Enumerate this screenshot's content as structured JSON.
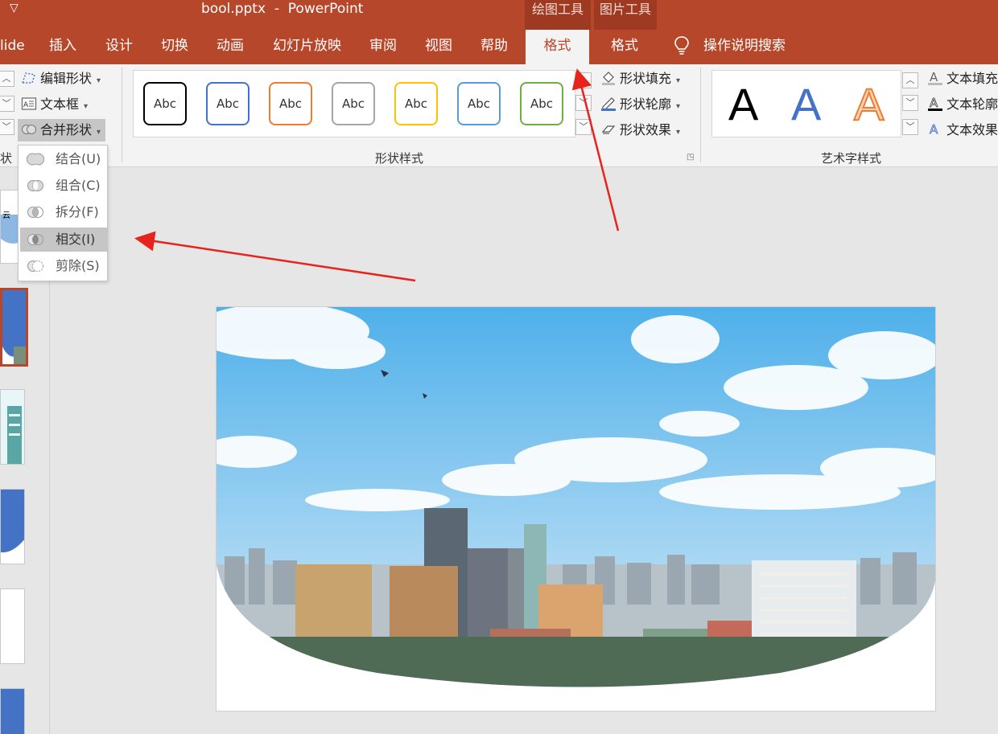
{
  "window": {
    "quick_access_arrow": "▽",
    "title": "bool.pptx  -  PowerPoint",
    "context_groups": {
      "drawing_tools": "绘图工具",
      "picture_tools": "图片工具"
    }
  },
  "tabs": [
    {
      "label": "lide"
    },
    {
      "label": "插入"
    },
    {
      "label": "设计"
    },
    {
      "label": "切换"
    },
    {
      "label": "动画"
    },
    {
      "label": "幻灯片放映"
    },
    {
      "label": "审阅"
    },
    {
      "label": "视图"
    },
    {
      "label": "帮助"
    },
    {
      "label": "格式",
      "active": true
    },
    {
      "label": "格式"
    }
  ],
  "tell_me": {
    "label": "操作说明搜索",
    "icon": "lightbulb-icon"
  },
  "ribbon": {
    "insert_shapes": {
      "edit_shape": "编辑形状",
      "text_box": "文本框",
      "merge_shapes": "合并形状",
      "group_label_partial": "状"
    },
    "shape_styles": {
      "label": "形状样式",
      "presets": [
        {
          "text": "Abc",
          "color": "#000000"
        },
        {
          "text": "Abc",
          "color": "#4472c4"
        },
        {
          "text": "Abc",
          "color": "#ed7d31"
        },
        {
          "text": "Abc",
          "color": "#a5a5a5"
        },
        {
          "text": "Abc",
          "color": "#ffc000"
        },
        {
          "text": "Abc",
          "color": "#5b9bd5"
        },
        {
          "text": "Abc",
          "color": "#70ad47"
        }
      ],
      "fill": "形状填充",
      "outline": "形状轮廓",
      "effects": "形状效果"
    },
    "wordart_styles": {
      "label": "艺术字样式",
      "samples": [
        {
          "letter": "A",
          "color": "#000000",
          "style": "solid"
        },
        {
          "letter": "A",
          "color": "#4472c4",
          "style": "gradient"
        },
        {
          "letter": "A",
          "color": "#ed7d31",
          "style": "outline"
        }
      ],
      "text_fill": "文本填充",
      "text_outline": "文本轮廓",
      "text_effects": "文本效果"
    }
  },
  "merge_menu": {
    "items": [
      {
        "label": "结合(U)",
        "icon": "union-icon"
      },
      {
        "label": "组合(C)",
        "icon": "combine-icon"
      },
      {
        "label": "拆分(F)",
        "icon": "fragment-icon"
      },
      {
        "label": "相交(I)",
        "icon": "intersect-icon",
        "highlighted": true
      },
      {
        "label": "剪除(S)",
        "icon": "subtract-icon"
      }
    ]
  },
  "colors": {
    "accent": "#b7472a",
    "context_tab": "#9e3a21",
    "annotation_arrow": "#e8231b"
  }
}
